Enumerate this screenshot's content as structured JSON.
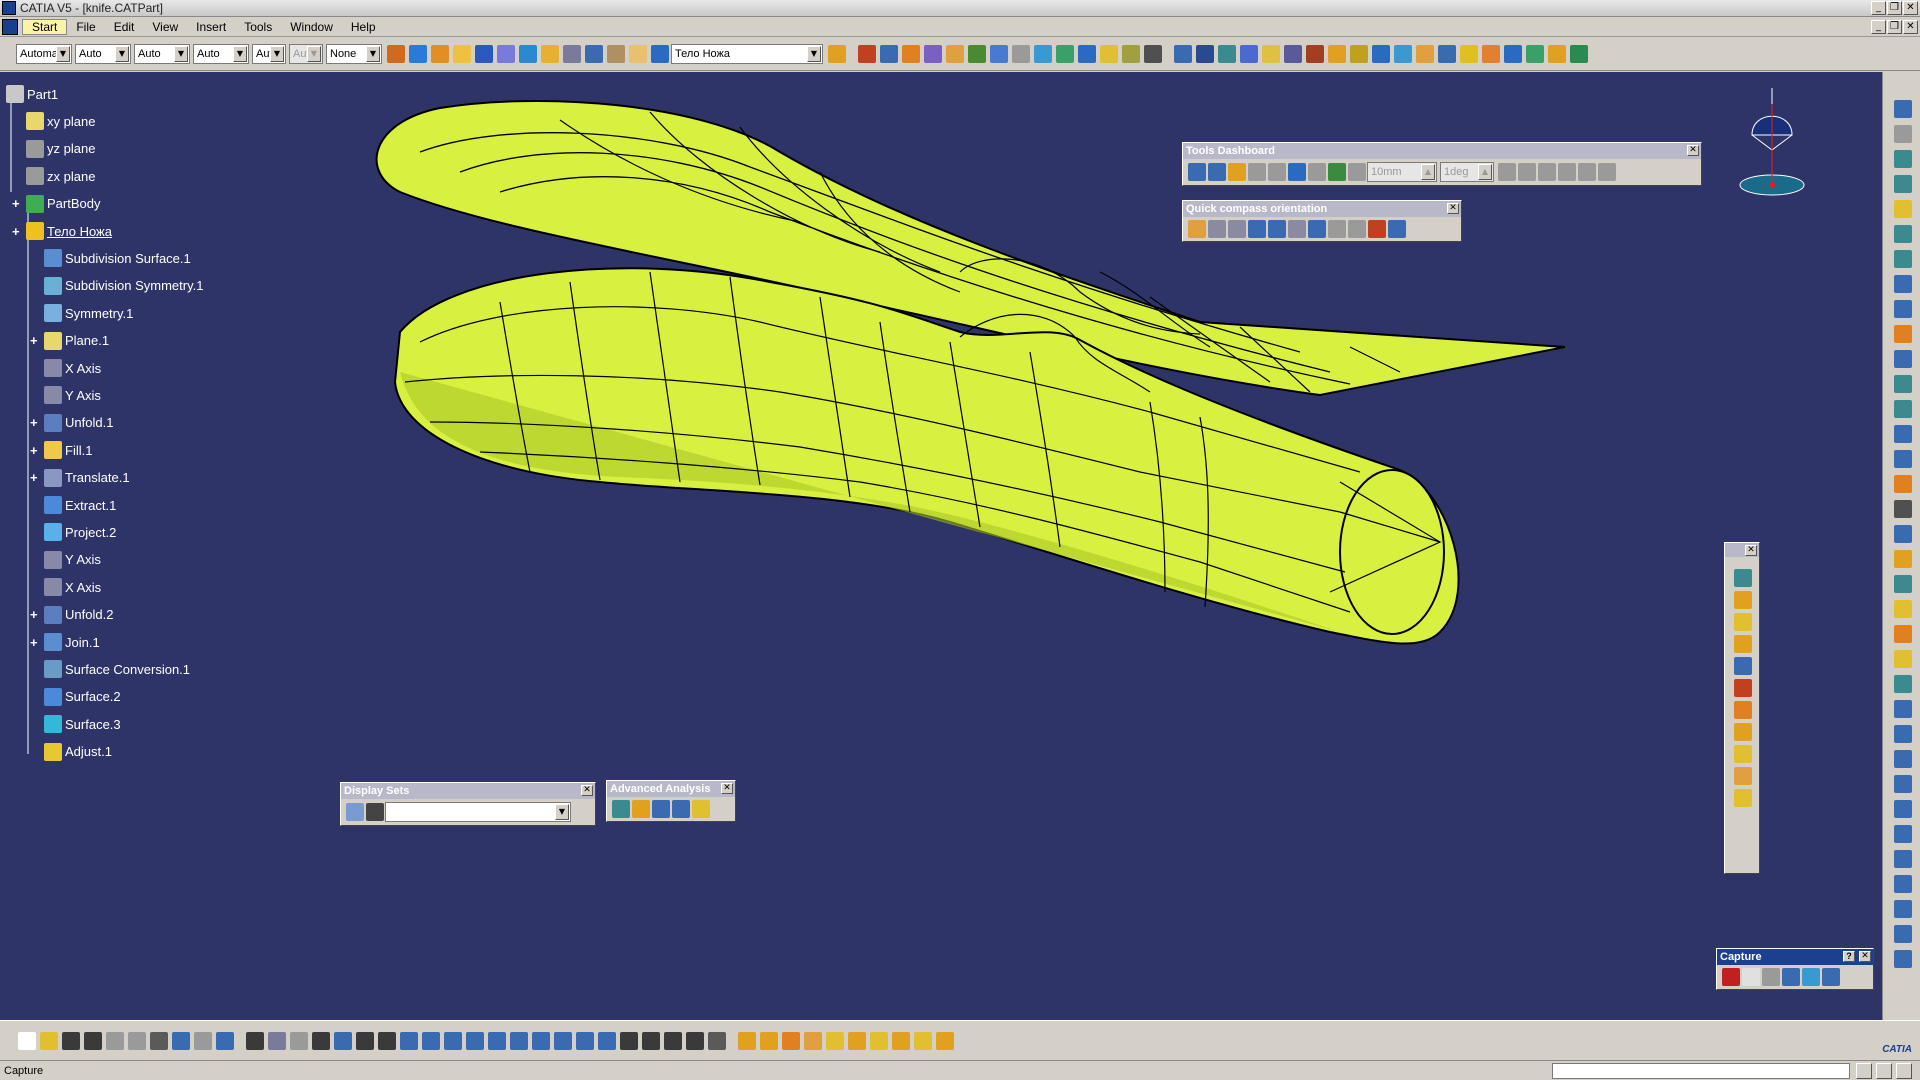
{
  "window": {
    "title": "CATIA V5 - [knife.CATPart]",
    "controls": [
      "_",
      "❐",
      "✕"
    ],
    "inner_controls": [
      "_",
      "❐",
      "✕"
    ]
  },
  "menu": {
    "items": [
      "Start",
      "File",
      "Edit",
      "View",
      "Insert",
      "Tools",
      "Window",
      "Help"
    ]
  },
  "toolbar_top": {
    "combos": [
      {
        "value": "Automa",
        "width": 56
      },
      {
        "value": "Auto",
        "width": 56
      },
      {
        "value": "Auto",
        "width": 56
      },
      {
        "value": "Auto",
        "width": 56
      },
      {
        "value": "Aut",
        "width": 34
      },
      {
        "value": "Aut",
        "width": 34,
        "disabled": true
      },
      {
        "value": "None",
        "width": 56
      }
    ],
    "current_body": "Тело Ножа"
  },
  "tree": {
    "nodes": [
      {
        "label": "Part1",
        "icon": "part-icon",
        "color": "#c8c8c8",
        "level": 0
      },
      {
        "label": "xy plane",
        "icon": "plane-icon",
        "color": "#e6d86a",
        "level": 1
      },
      {
        "label": "yz plane",
        "icon": "plane-icon",
        "color": "#9a9a9a",
        "level": 1
      },
      {
        "label": "zx plane",
        "icon": "plane-icon",
        "color": "#9a9a9a",
        "level": 1
      },
      {
        "label": "PartBody",
        "icon": "gear-icon",
        "color": "#3fae52",
        "level": 1,
        "expander": true
      },
      {
        "label": "Тело Ножа",
        "icon": "geometrical-set-icon",
        "color": "#f0c020",
        "level": 1,
        "expander": true,
        "underline": true
      },
      {
        "label": "Subdivision Surface.1",
        "icon": "subdivision-surface-icon",
        "color": "#5a8ed0",
        "level": 2
      },
      {
        "label": "Subdivision Symmetry.1",
        "icon": "subdivision-symmetry-icon",
        "color": "#69b0d6",
        "level": 2
      },
      {
        "label": "Symmetry.1",
        "icon": "symmetry-icon",
        "color": "#7ab0e0",
        "level": 2
      },
      {
        "label": "Plane.1",
        "icon": "plane-icon",
        "color": "#e6d86a",
        "level": 2,
        "expander": true
      },
      {
        "label": "X Axis",
        "icon": "axis-icon",
        "color": "#8888a8",
        "level": 2
      },
      {
        "label": "Y Axis",
        "icon": "axis-icon",
        "color": "#8888a8",
        "level": 2
      },
      {
        "label": "Unfold.1",
        "icon": "unfold-icon",
        "color": "#5a7ec0",
        "level": 2,
        "expander": true
      },
      {
        "label": "Fill.1",
        "icon": "fill-icon",
        "color": "#f2c84a",
        "level": 2,
        "expander": true
      },
      {
        "label": "Translate.1",
        "icon": "translate-icon",
        "color": "#8898c0",
        "level": 2,
        "expander": true
      },
      {
        "label": "Extract.1",
        "icon": "extract-icon",
        "color": "#4a8ad8",
        "level": 2
      },
      {
        "label": "Project.2",
        "icon": "project-icon",
        "color": "#5ab0e8",
        "level": 2
      },
      {
        "label": "Y Axis",
        "icon": "axis-icon",
        "color": "#8888a8",
        "level": 2
      },
      {
        "label": "X Axis",
        "icon": "axis-icon",
        "color": "#8888a8",
        "level": 2
      },
      {
        "label": "Unfold.2",
        "icon": "unfold-icon",
        "color": "#5a7ec0",
        "level": 2,
        "expander": true
      },
      {
        "label": "Join.1",
        "icon": "join-icon",
        "color": "#5a8ed0",
        "level": 2,
        "expander": true
      },
      {
        "label": "Surface Conversion.1",
        "icon": "surface-conversion-icon",
        "color": "#6a9ac8",
        "level": 2
      },
      {
        "label": "Surface.2",
        "icon": "surface-icon",
        "color": "#4a8ad8",
        "level": 2
      },
      {
        "label": "Surface.3",
        "icon": "surface-icon",
        "color": "#33b8d8",
        "level": 2
      },
      {
        "label": "Adjust.1",
        "icon": "adjust-icon",
        "color": "#e8c830",
        "level": 2
      }
    ]
  },
  "tools_dashboard": {
    "title": "Tools Dashboard",
    "step_field": "10mm",
    "angle_field": "1deg"
  },
  "quick_compass": {
    "title": "Quick compass orientation"
  },
  "display_sets": {
    "title": "Display Sets",
    "selected": ""
  },
  "advanced_analysis": {
    "title": "Advanced Analysis"
  },
  "capture": {
    "title": "Capture",
    "help": "?"
  },
  "status": {
    "text": "Capture"
  },
  "brand": {
    "name": "CATIA"
  },
  "colors": {
    "viewport_bg": "#2f3468",
    "surface": "#d8f040",
    "surface_shadow": "#8fa020",
    "toolbar_bg": "#d4d0c8"
  }
}
